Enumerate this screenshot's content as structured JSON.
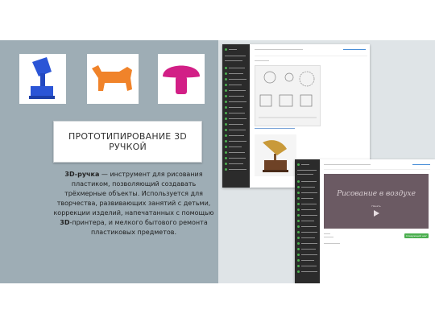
{
  "slide": {
    "title": "ПРОТОТИПИРОВАНИЕ 3D РУЧКОЙ",
    "body": {
      "term": "3D-ручка",
      "text1": " — инструмент для рисования пластиком, позволяющий создавать трёхмерные объекты. Используется для творчества, развивающих занятий с детьми, коррекции изделий, напечатанных с помощью ",
      "term2": "3D",
      "text2": "-принтера, и мелкого бытового ремонта пластиковых предметов."
    }
  },
  "screens": {
    "video_caption": "Рисование в воздухе",
    "video_button": "Начать",
    "next_button": "Следующий шаг"
  },
  "colors": {
    "slide_bg": "#9eadb5",
    "panel_bg": "#dfe4e7",
    "sidebar": "#2b2b2b",
    "accent_green": "#4caf50",
    "gramophone_blue": "#2b55d6",
    "dog_orange": "#f0832a",
    "mushroom_magenta": "#d21f86",
    "video_bg": "#6b5a63"
  },
  "icons": [
    "gramophone-model-icon",
    "dog-figure-icon",
    "mushroom-figure-icon",
    "play-icon"
  ]
}
